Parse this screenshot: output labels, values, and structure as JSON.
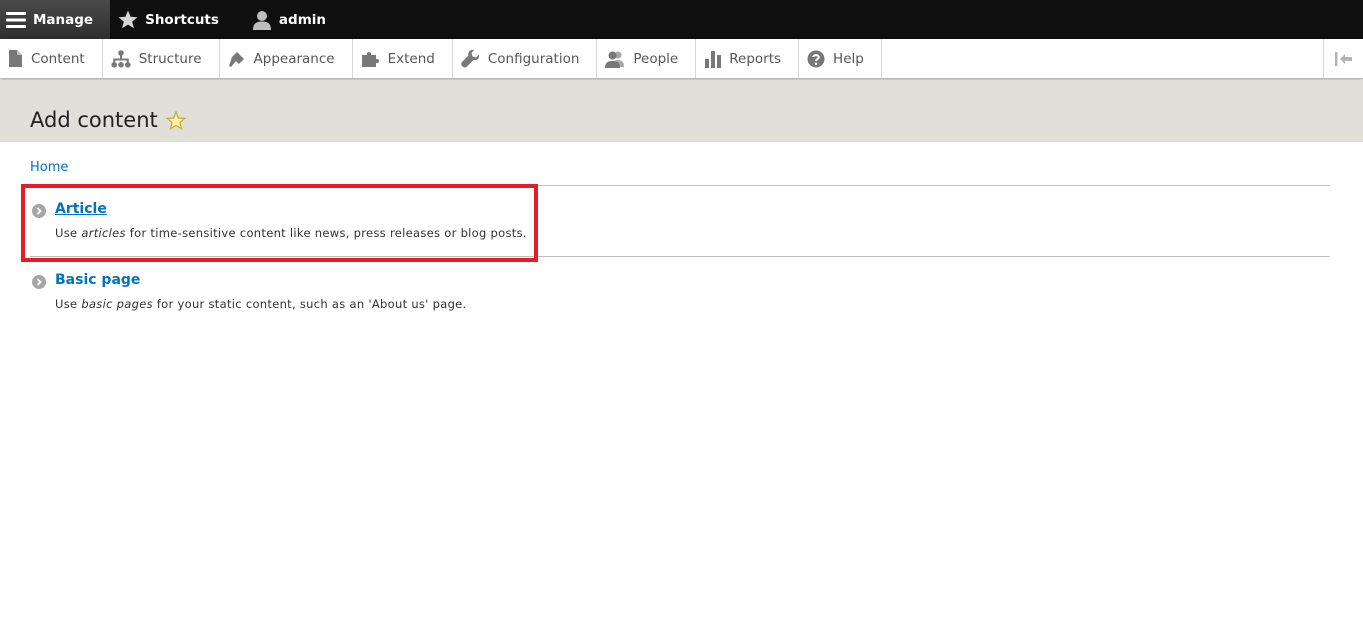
{
  "toolbar": {
    "manage_label": "Manage",
    "shortcuts_label": "Shortcuts",
    "user_label": "admin"
  },
  "tray": {
    "items": [
      {
        "label": "Content",
        "icon": "file-icon"
      },
      {
        "label": "Structure",
        "icon": "sitemap-icon"
      },
      {
        "label": "Appearance",
        "icon": "paintbrush-icon"
      },
      {
        "label": "Extend",
        "icon": "puzzle-icon"
      },
      {
        "label": "Configuration",
        "icon": "wrench-icon"
      },
      {
        "label": "People",
        "icon": "people-icon"
      },
      {
        "label": "Reports",
        "icon": "bar-chart-icon"
      },
      {
        "label": "Help",
        "icon": "question-icon"
      }
    ]
  },
  "page": {
    "title": "Add content"
  },
  "breadcrumb": {
    "home": "Home"
  },
  "content_types": [
    {
      "name": "Article",
      "desc_prefix": "Use ",
      "desc_em": "articles",
      "desc_suffix": " for time-sensitive content like news, press releases or blog posts."
    },
    {
      "name": "Basic page",
      "desc_prefix": "Use ",
      "desc_em": "basic pages",
      "desc_suffix": " for your static content, such as an 'About us' page."
    }
  ],
  "colors": {
    "link": "#0074bd",
    "highlight": "#e31e2a",
    "header_bg": "#e0e0d8",
    "toolbar_bg": "#0f0f0f"
  }
}
